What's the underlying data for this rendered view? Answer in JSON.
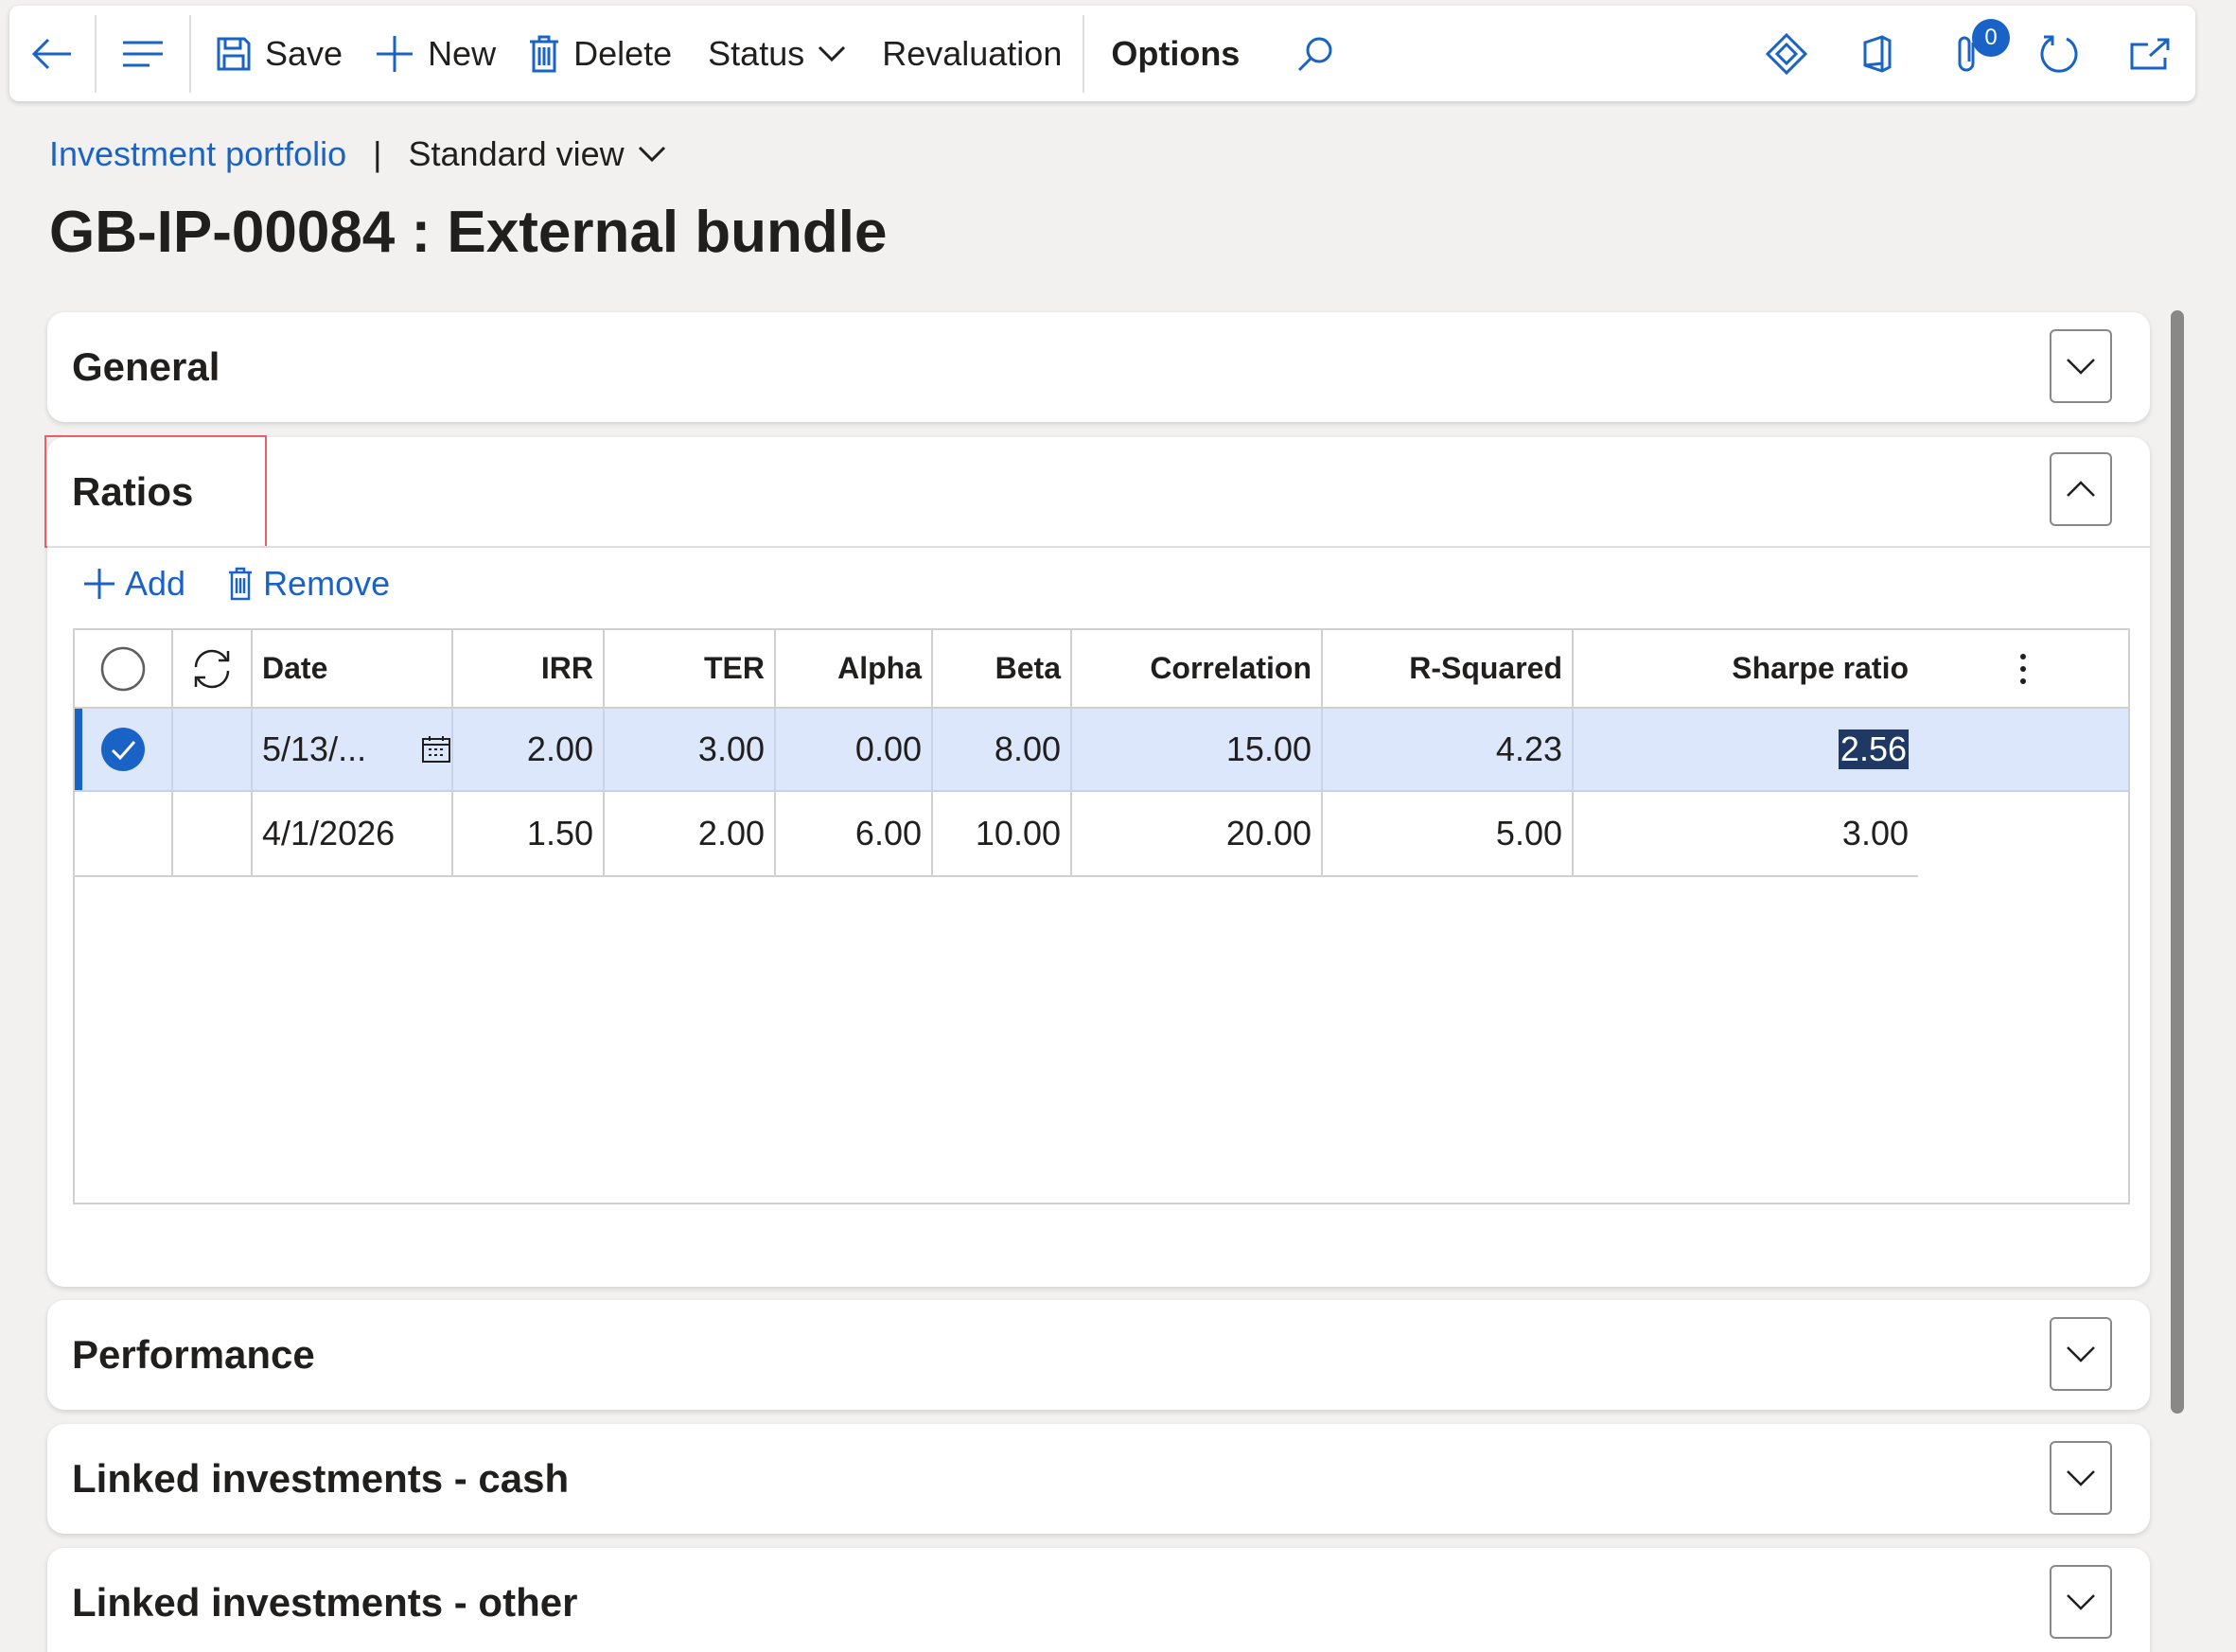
{
  "toolbar": {
    "save_label": "Save",
    "new_label": "New",
    "delete_label": "Delete",
    "status_label": "Status",
    "revaluation_label": "Revaluation",
    "options_label": "Options",
    "attachments_count": "0"
  },
  "breadcrumb": {
    "link": "Investment portfolio",
    "separator": "|",
    "view": "Standard view"
  },
  "page_title": "GB-IP-00084 : External bundle",
  "sections": {
    "general": "General",
    "ratios": "Ratios",
    "performance": "Performance",
    "linked_cash": "Linked investments - cash",
    "linked_other": "Linked investments - other"
  },
  "ratios": {
    "add_label": "Add",
    "remove_label": "Remove",
    "columns": [
      "Date",
      "IRR",
      "TER",
      "Alpha",
      "Beta",
      "Correlation",
      "R-Squared",
      "Sharpe ratio"
    ],
    "rows": [
      {
        "date": "5/13/...",
        "irr": "2.00",
        "ter": "3.00",
        "alpha": "0.00",
        "beta": "8.00",
        "correlation": "15.00",
        "r_squared": "4.23",
        "sharpe": "2.56",
        "selected": true
      },
      {
        "date": "4/1/2026",
        "irr": "1.50",
        "ter": "2.00",
        "alpha": "6.00",
        "beta": "10.00",
        "correlation": "20.00",
        "r_squared": "5.00",
        "sharpe": "3.00",
        "selected": false
      }
    ]
  },
  "colors": {
    "accent": "#1a63c6",
    "selected_row": "#dde7fb",
    "highlight_box": "#e85f6a",
    "text_selection": "#1f3864"
  }
}
